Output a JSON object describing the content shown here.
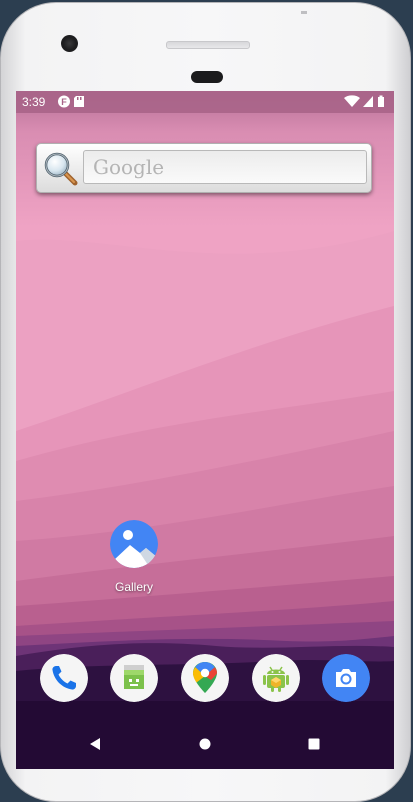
{
  "status_bar": {
    "time": "3:39",
    "left_icons": [
      "notification-icon",
      "sd-card-icon"
    ],
    "right_icons": [
      "wifi-icon",
      "cell-signal-icon",
      "battery-icon"
    ]
  },
  "search_widget": {
    "placeholder": "Google",
    "icon": "magnifier-icon"
  },
  "home_apps": [
    {
      "label": "Gallery",
      "icon": "gallery-icon"
    }
  ],
  "dock": [
    {
      "name": "phone",
      "icon": "phone-icon"
    },
    {
      "name": "messaging",
      "icon": "messaging-icon"
    },
    {
      "name": "maps",
      "icon": "maps-icon"
    },
    {
      "name": "android-app",
      "icon": "android-icon"
    },
    {
      "name": "camera",
      "icon": "camera-icon"
    }
  ],
  "nav_bar": {
    "buttons": [
      "back-icon",
      "home-icon",
      "recents-icon"
    ]
  },
  "colors": {
    "wallpaper_sky": "#efa3c4",
    "wallpaper_dark": "#2a0f3a",
    "accent_blue": "#4285f4"
  }
}
